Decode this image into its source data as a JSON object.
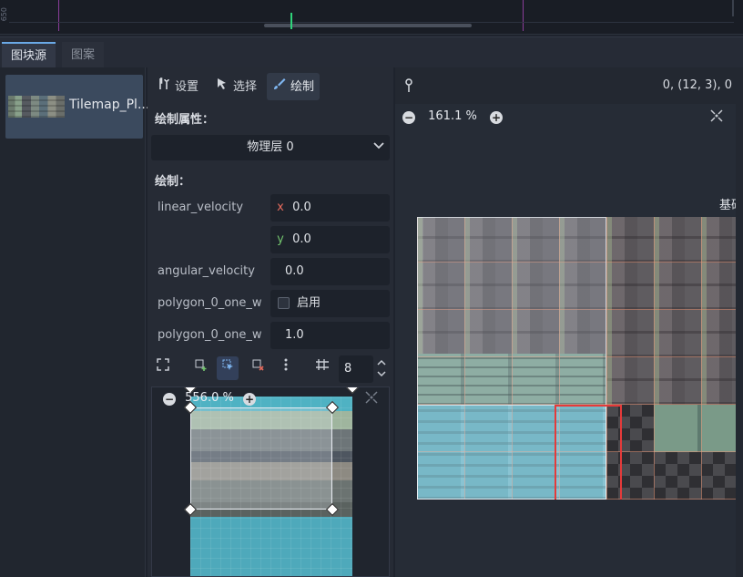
{
  "timeline": {
    "ruler_label": "650"
  },
  "tabs": {
    "active": "图块源",
    "inactive": "图案"
  },
  "atlas_list": {
    "item_label": "Tilemap_Pl..."
  },
  "toolbar": {
    "setup_label": "设置",
    "select_label": "选择",
    "paint_label": "绘制"
  },
  "paint": {
    "properties_title": "绘制属性：",
    "layer_dropdown": "物理层 0",
    "paint_title": "绘制：",
    "props": {
      "linear_velocity_label": "linear_velocity",
      "linear_velocity_x_axis": "x",
      "linear_velocity_x": "0.0",
      "linear_velocity_y_axis": "y",
      "linear_velocity_y": "0.0",
      "angular_velocity_label": "angular_velocity",
      "angular_velocity": "0.0",
      "one_way_label": "polygon_0_one_w",
      "one_way_checkbox_label": "启用",
      "one_way_margin_label": "polygon_0_one_w",
      "one_way_margin": "1.0"
    },
    "grid_snap_value": "8"
  },
  "polygon_editor": {
    "zoom": "556.0 %"
  },
  "atlas_view": {
    "coords": "0, (12, 3), 0",
    "zoom": "161.1 %",
    "label": "基础"
  },
  "icons": {
    "setup": "wrench-icon",
    "select": "cursor-icon",
    "paint": "brush-icon",
    "pin": "pin-icon",
    "zoom_out": "minus-circle-icon",
    "zoom_in": "plus-circle-icon",
    "center": "center-view-icon"
  },
  "colors": {
    "accent": "#6aa9e6",
    "selection": "#e53a3a",
    "axis_x": "#e46a5c",
    "axis_y": "#73c46e"
  }
}
